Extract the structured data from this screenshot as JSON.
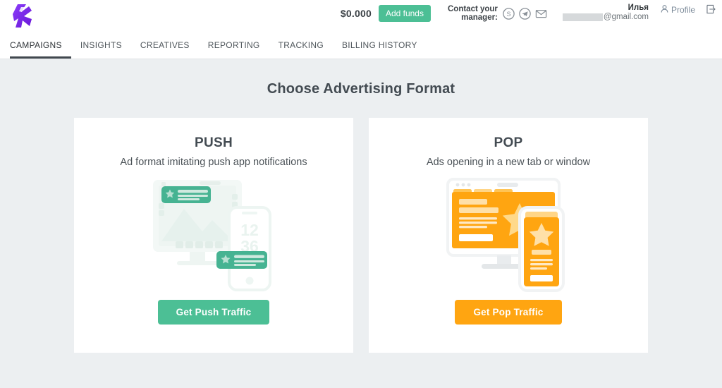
{
  "header": {
    "logo_icon": "rocket-r-logo",
    "balance": "$0.000",
    "add_funds_label": "Add funds",
    "contact_label_line1": "Contact your",
    "contact_label_line2": "manager:",
    "contact_icons": [
      {
        "name": "skype-icon",
        "title": "Skype"
      },
      {
        "name": "telegram-icon",
        "title": "Telegram"
      },
      {
        "name": "email-icon",
        "title": "Email"
      }
    ],
    "user_name": "Илья",
    "user_email": "@gmail.com",
    "profile_label": "Profile",
    "profile_icon": "user-icon",
    "logout_icon": "logout-icon"
  },
  "nav": {
    "items": [
      {
        "label": "CAMPAIGNS",
        "active": true
      },
      {
        "label": "INSIGHTS",
        "active": false
      },
      {
        "label": "CREATIVES",
        "active": false
      },
      {
        "label": "REPORTING",
        "active": false
      },
      {
        "label": "TRACKING",
        "active": false
      },
      {
        "label": "BILLING HISTORY",
        "active": false
      }
    ]
  },
  "main": {
    "page_title": "Choose Advertising Format",
    "cards": [
      {
        "title": "PUSH",
        "subtitle": "Ad format imitating push app notifications",
        "cta_label": "Get Push Traffic",
        "accent_color": "#4cbf95",
        "illustration": "push-notification-illustration",
        "phone_clock_top": "12",
        "phone_clock_bottom": "36"
      },
      {
        "title": "POP",
        "subtitle": "Ads opening in a new tab or window",
        "cta_label": "Get Pop Traffic",
        "accent_color": "#ffa511",
        "illustration": "popup-window-illustration"
      }
    ]
  },
  "colors": {
    "page_background": "#eceff1",
    "card_background": "#ffffff",
    "green_accent": "#4cbf95",
    "orange_accent": "#ffa511",
    "logo_purple": "#7b2ff7",
    "text_dark": "#434b52"
  }
}
